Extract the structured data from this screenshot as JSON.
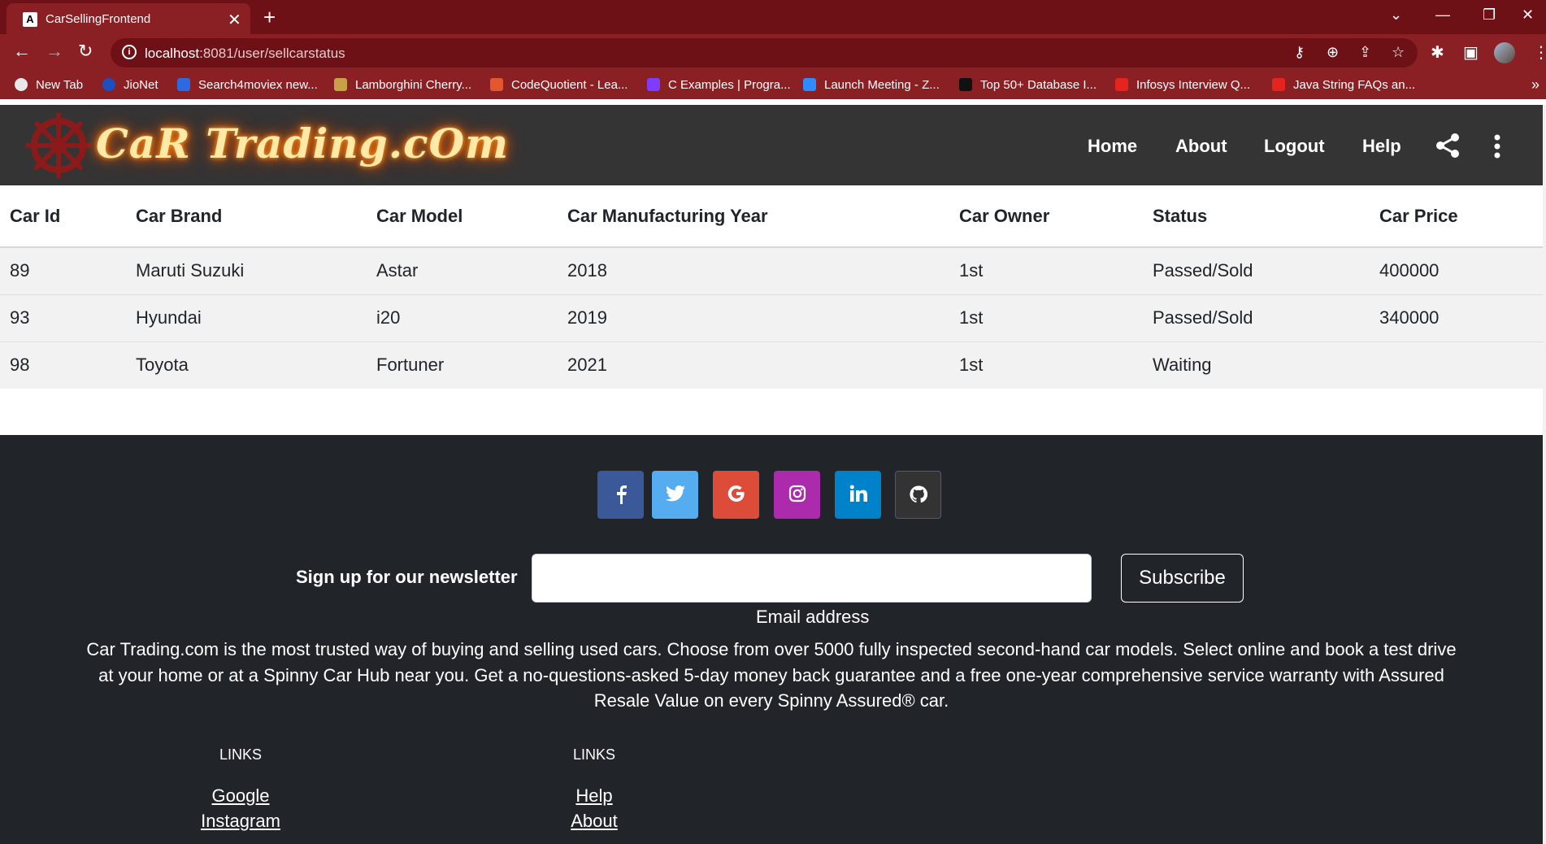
{
  "browser": {
    "tab_title": "CarSellingFrontend",
    "tab_favicon": "A",
    "url_host": "localhost",
    "url_path": ":8081/user/sellcarstatus"
  },
  "bookmarks": [
    {
      "label": "New Tab",
      "icon_color": "#e8e8e8"
    },
    {
      "label": "JioNet",
      "icon_color": "#1d4fbf"
    },
    {
      "label": "Search4moviex new...",
      "icon_color": "#2d6ae0"
    },
    {
      "label": "Lamborghini Cherry...",
      "icon_color": "#c9a04a"
    },
    {
      "label": "CodeQuotient - Lea...",
      "icon_color": "#e4572e"
    },
    {
      "label": "C Examples | Progra...",
      "icon_color": "#7d3cff"
    },
    {
      "label": "Launch Meeting - Z...",
      "icon_color": "#2d8cff"
    },
    {
      "label": "Top 50+ Database I...",
      "icon_color": "#111111"
    },
    {
      "label": "Infosys Interview Q...",
      "icon_color": "#e5241d"
    },
    {
      "label": "Java String FAQs an...",
      "icon_color": "#e5241d"
    }
  ],
  "site": {
    "logo_text": "CaR Trading.cOm",
    "nav": [
      "Home",
      "About",
      "Logout",
      "Help"
    ]
  },
  "table": {
    "headers": [
      "Car Id",
      "Car Brand",
      "Car Model",
      "Car Manufacturing Year",
      "Car Owner",
      "Status",
      "Car Price"
    ],
    "rows": [
      [
        "89",
        "Maruti Suzuki",
        "Astar",
        "2018",
        "1st",
        "Passed/Sold",
        "400000"
      ],
      [
        "93",
        "Hyundai",
        "i20",
        "2019",
        "1st",
        "Passed/Sold",
        "340000"
      ],
      [
        "98",
        "Toyota",
        "Fortuner",
        "2021",
        "1st",
        "Waiting",
        ""
      ]
    ]
  },
  "footer": {
    "social": [
      {
        "name": "facebook",
        "color": "#3b5998"
      },
      {
        "name": "twitter",
        "color": "#55acee"
      },
      {
        "name": "google",
        "color": "#dd4b39"
      },
      {
        "name": "instagram",
        "color": "#ac2bac"
      },
      {
        "name": "linkedin",
        "color": "#0082ca"
      },
      {
        "name": "github",
        "color": "#333333"
      }
    ],
    "newsletter_label": "Sign up for our newsletter",
    "email_value": "",
    "email_help": "Email address",
    "subscribe_label": "Subscribe",
    "about_text": "Car Trading.com is the most trusted way of buying and selling used cars. Choose from over 5000 fully inspected second-hand car models. Select online and book a test drive at your home or at a Spinny Car Hub near you. Get a no-questions-asked 5-day money back guarantee and a free one-year comprehensive service warranty with Assured Resale Value on every Spinny Assured® car.",
    "links_left_heading": "LINKS",
    "links_left": [
      "Google",
      "Instagram"
    ],
    "links_right_heading": "LINKS",
    "links_right": [
      "Help",
      "About"
    ]
  }
}
